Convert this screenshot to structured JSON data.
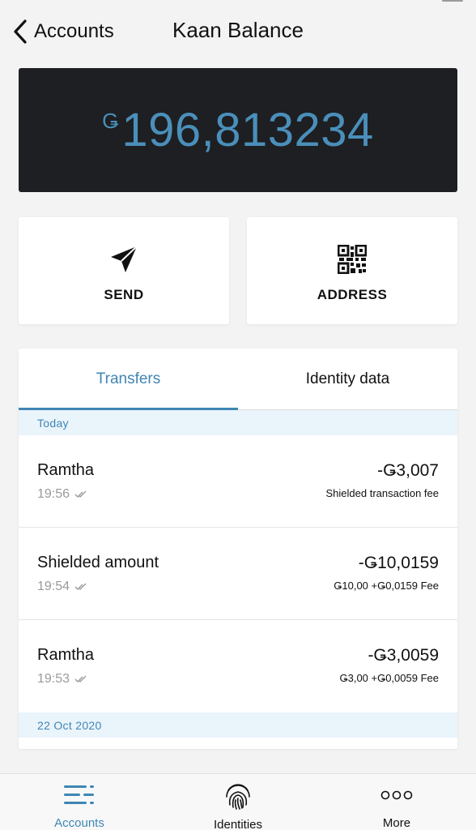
{
  "header": {
    "back_label": "Accounts",
    "title": "Kaan Balance"
  },
  "balance": {
    "currency_symbol": "Ǥ",
    "amount": "196,813234"
  },
  "actions": {
    "send_label": "SEND",
    "address_label": "ADDRESS"
  },
  "tabs": [
    {
      "label": "Transfers",
      "active": true
    },
    {
      "label": "Identity data",
      "active": false
    }
  ],
  "groups": [
    {
      "date": "Today",
      "transactions": [
        {
          "name": "Ramtha",
          "time": "19:56",
          "amount": "-Ǥ3,007",
          "note": "Shielded transaction fee"
        },
        {
          "name": "Shielded amount",
          "time": "19:54",
          "amount": "-Ǥ10,0159",
          "note": "Ǥ10,00 +Ǥ0,0159 Fee"
        },
        {
          "name": "Ramtha",
          "time": "19:53",
          "amount": "-Ǥ3,0059",
          "note": "Ǥ3,00 +Ǥ0,0059 Fee"
        }
      ]
    },
    {
      "date": "22 Oct 2020",
      "transactions": []
    }
  ],
  "bottom_nav": [
    {
      "label": "Accounts",
      "icon": "accounts-list-icon",
      "active": true
    },
    {
      "label": "Identities",
      "icon": "fingerprint-icon",
      "active": false
    },
    {
      "label": "More",
      "icon": "more-dots-icon",
      "active": false
    }
  ],
  "colors": {
    "accent": "#3f86b4",
    "balance_text": "#4a8fbb",
    "balance_bg": "#1e1f22",
    "date_header_bg": "#eaf4fb"
  }
}
